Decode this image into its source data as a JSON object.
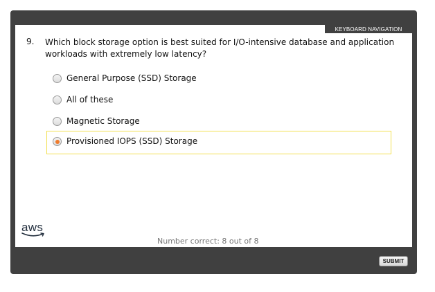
{
  "header": {
    "keyboard_nav_label": "KEYBOARD NAVIGATION"
  },
  "question": {
    "number": "9.",
    "text": "Which block storage option is best suited for I/O-intensive database and application workloads with extremely low latency?",
    "options": [
      {
        "label": "General Purpose (SSD) Storage",
        "selected": false
      },
      {
        "label": "All of these",
        "selected": false
      },
      {
        "label": "Magnetic Storage",
        "selected": false
      },
      {
        "label": "Provisioned IOPS (SSD) Storage",
        "selected": true
      }
    ]
  },
  "footer": {
    "logo_text": "aws",
    "score_text": "Number correct: 8 out of 8",
    "submit_label": "SUBMIT"
  },
  "colors": {
    "frame": "#404040",
    "selected_border": "#f2e04f",
    "radio_dot": "#f07c2d",
    "aws_smile": "#232f3e"
  }
}
